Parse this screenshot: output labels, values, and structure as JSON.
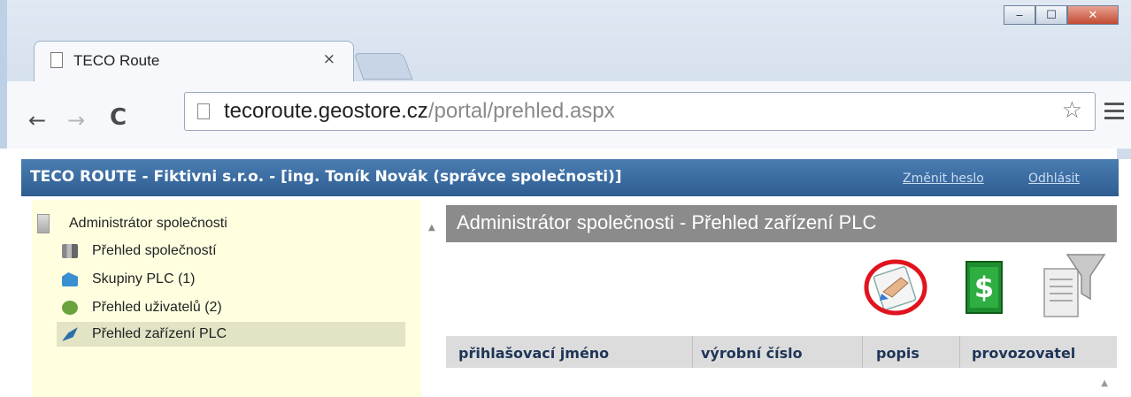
{
  "browser": {
    "tab_title": "TECO Route",
    "tab_close": "×",
    "url_host": "tecoroute.geostore.cz",
    "url_path": "/portal/prehled.aspx",
    "window_controls": [
      "minimize",
      "maximize",
      "close"
    ]
  },
  "header": {
    "title": "TECO ROUTE - Fiktivni s.r.o. - [ing. Toník Novák (správce společnosti)]",
    "links": {
      "change_password": "Změnit heslo",
      "logout": "Odhlásit"
    }
  },
  "sidebar": {
    "root": "Administrátor společnosti",
    "items": [
      {
        "label": "Přehled společností",
        "icon": "companies-icon"
      },
      {
        "label": "Skupiny PLC (1)",
        "icon": "groups-icon"
      },
      {
        "label": "Přehled uživatelů (2)",
        "icon": "users-icon"
      },
      {
        "label": "Přehled zařízení PLC",
        "icon": "plc-devices-icon",
        "selected": true
      }
    ]
  },
  "main": {
    "title": "Administrátor společnosti - Přehled zařízení PLC",
    "toolbar_icons": [
      "edit-icon",
      "money-icon",
      "filter-icon"
    ],
    "table": {
      "columns": [
        "přihlašovací jméno",
        "výrobní číslo",
        "popis",
        "provozovatel"
      ]
    }
  },
  "colors": {
    "header_bar": "#2e5d91",
    "sidebar_bg": "#ffffe0",
    "main_header_bg": "#8b8b8b",
    "highlight_ring": "#e0141e"
  }
}
